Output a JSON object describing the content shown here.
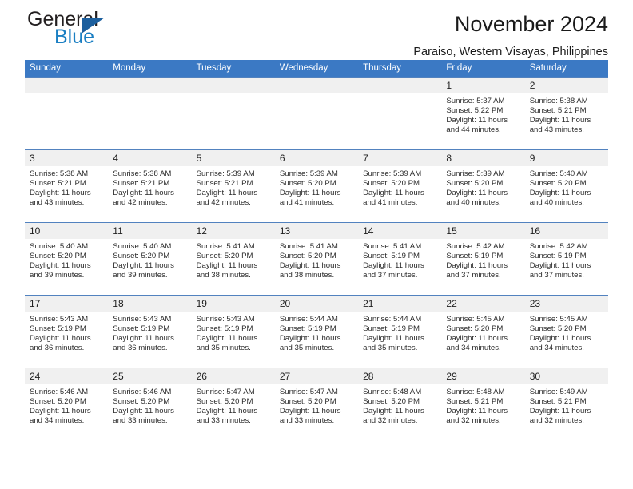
{
  "logo": {
    "word_one": "General",
    "word_two": "Blue",
    "triangle_color": "#1c5f9e",
    "blue_color": "#1b7fc3"
  },
  "header": {
    "title": "November 2024",
    "subtitle": "Paraiso, Western Visayas, Philippines",
    "accent_color": "#3b79c4"
  },
  "weekdays": [
    "Sunday",
    "Monday",
    "Tuesday",
    "Wednesday",
    "Thursday",
    "Friday",
    "Saturday"
  ],
  "labels": {
    "sunrise": "Sunrise:",
    "sunset": "Sunset:",
    "daylight": "Daylight:"
  },
  "weeks": [
    [
      {
        "day": "",
        "empty": true
      },
      {
        "day": "",
        "empty": true
      },
      {
        "day": "",
        "empty": true
      },
      {
        "day": "",
        "empty": true
      },
      {
        "day": "",
        "empty": true
      },
      {
        "day": "1",
        "sunrise": "Sunrise: 5:37 AM",
        "sunset": "Sunset: 5:22 PM",
        "daylight": "Daylight: 11 hours and 44 minutes."
      },
      {
        "day": "2",
        "sunrise": "Sunrise: 5:38 AM",
        "sunset": "Sunset: 5:21 PM",
        "daylight": "Daylight: 11 hours and 43 minutes."
      }
    ],
    [
      {
        "day": "3",
        "sunrise": "Sunrise: 5:38 AM",
        "sunset": "Sunset: 5:21 PM",
        "daylight": "Daylight: 11 hours and 43 minutes."
      },
      {
        "day": "4",
        "sunrise": "Sunrise: 5:38 AM",
        "sunset": "Sunset: 5:21 PM",
        "daylight": "Daylight: 11 hours and 42 minutes."
      },
      {
        "day": "5",
        "sunrise": "Sunrise: 5:39 AM",
        "sunset": "Sunset: 5:21 PM",
        "daylight": "Daylight: 11 hours and 42 minutes."
      },
      {
        "day": "6",
        "sunrise": "Sunrise: 5:39 AM",
        "sunset": "Sunset: 5:20 PM",
        "daylight": "Daylight: 11 hours and 41 minutes."
      },
      {
        "day": "7",
        "sunrise": "Sunrise: 5:39 AM",
        "sunset": "Sunset: 5:20 PM",
        "daylight": "Daylight: 11 hours and 41 minutes."
      },
      {
        "day": "8",
        "sunrise": "Sunrise: 5:39 AM",
        "sunset": "Sunset: 5:20 PM",
        "daylight": "Daylight: 11 hours and 40 minutes."
      },
      {
        "day": "9",
        "sunrise": "Sunrise: 5:40 AM",
        "sunset": "Sunset: 5:20 PM",
        "daylight": "Daylight: 11 hours and 40 minutes."
      }
    ],
    [
      {
        "day": "10",
        "sunrise": "Sunrise: 5:40 AM",
        "sunset": "Sunset: 5:20 PM",
        "daylight": "Daylight: 11 hours and 39 minutes."
      },
      {
        "day": "11",
        "sunrise": "Sunrise: 5:40 AM",
        "sunset": "Sunset: 5:20 PM",
        "daylight": "Daylight: 11 hours and 39 minutes."
      },
      {
        "day": "12",
        "sunrise": "Sunrise: 5:41 AM",
        "sunset": "Sunset: 5:20 PM",
        "daylight": "Daylight: 11 hours and 38 minutes."
      },
      {
        "day": "13",
        "sunrise": "Sunrise: 5:41 AM",
        "sunset": "Sunset: 5:20 PM",
        "daylight": "Daylight: 11 hours and 38 minutes."
      },
      {
        "day": "14",
        "sunrise": "Sunrise: 5:41 AM",
        "sunset": "Sunset: 5:19 PM",
        "daylight": "Daylight: 11 hours and 37 minutes."
      },
      {
        "day": "15",
        "sunrise": "Sunrise: 5:42 AM",
        "sunset": "Sunset: 5:19 PM",
        "daylight": "Daylight: 11 hours and 37 minutes."
      },
      {
        "day": "16",
        "sunrise": "Sunrise: 5:42 AM",
        "sunset": "Sunset: 5:19 PM",
        "daylight": "Daylight: 11 hours and 37 minutes."
      }
    ],
    [
      {
        "day": "17",
        "sunrise": "Sunrise: 5:43 AM",
        "sunset": "Sunset: 5:19 PM",
        "daylight": "Daylight: 11 hours and 36 minutes."
      },
      {
        "day": "18",
        "sunrise": "Sunrise: 5:43 AM",
        "sunset": "Sunset: 5:19 PM",
        "daylight": "Daylight: 11 hours and 36 minutes."
      },
      {
        "day": "19",
        "sunrise": "Sunrise: 5:43 AM",
        "sunset": "Sunset: 5:19 PM",
        "daylight": "Daylight: 11 hours and 35 minutes."
      },
      {
        "day": "20",
        "sunrise": "Sunrise: 5:44 AM",
        "sunset": "Sunset: 5:19 PM",
        "daylight": "Daylight: 11 hours and 35 minutes."
      },
      {
        "day": "21",
        "sunrise": "Sunrise: 5:44 AM",
        "sunset": "Sunset: 5:19 PM",
        "daylight": "Daylight: 11 hours and 35 minutes."
      },
      {
        "day": "22",
        "sunrise": "Sunrise: 5:45 AM",
        "sunset": "Sunset: 5:20 PM",
        "daylight": "Daylight: 11 hours and 34 minutes."
      },
      {
        "day": "23",
        "sunrise": "Sunrise: 5:45 AM",
        "sunset": "Sunset: 5:20 PM",
        "daylight": "Daylight: 11 hours and 34 minutes."
      }
    ],
    [
      {
        "day": "24",
        "sunrise": "Sunrise: 5:46 AM",
        "sunset": "Sunset: 5:20 PM",
        "daylight": "Daylight: 11 hours and 34 minutes."
      },
      {
        "day": "25",
        "sunrise": "Sunrise: 5:46 AM",
        "sunset": "Sunset: 5:20 PM",
        "daylight": "Daylight: 11 hours and 33 minutes."
      },
      {
        "day": "26",
        "sunrise": "Sunrise: 5:47 AM",
        "sunset": "Sunset: 5:20 PM",
        "daylight": "Daylight: 11 hours and 33 minutes."
      },
      {
        "day": "27",
        "sunrise": "Sunrise: 5:47 AM",
        "sunset": "Sunset: 5:20 PM",
        "daylight": "Daylight: 11 hours and 33 minutes."
      },
      {
        "day": "28",
        "sunrise": "Sunrise: 5:48 AM",
        "sunset": "Sunset: 5:20 PM",
        "daylight": "Daylight: 11 hours and 32 minutes."
      },
      {
        "day": "29",
        "sunrise": "Sunrise: 5:48 AM",
        "sunset": "Sunset: 5:21 PM",
        "daylight": "Daylight: 11 hours and 32 minutes."
      },
      {
        "day": "30",
        "sunrise": "Sunrise: 5:49 AM",
        "sunset": "Sunset: 5:21 PM",
        "daylight": "Daylight: 11 hours and 32 minutes."
      }
    ]
  ]
}
